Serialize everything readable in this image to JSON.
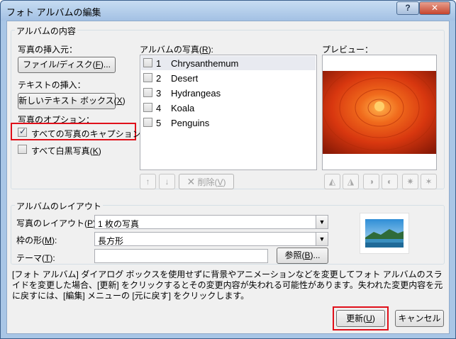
{
  "window": {
    "title": "フォト アルバムの編集",
    "help_glyph": "?",
    "close_glyph": "✕"
  },
  "album_contents": {
    "group_label": "アルバムの内容",
    "insert_from_label": "写真の挿入元：",
    "file_disk_button": {
      "text": "ファイル/ディスク(",
      "key": "F",
      "tail": ")..."
    },
    "insert_text_label": "テキストの挿入：",
    "new_textbox_button": {
      "text": "新しいテキスト ボックス(",
      "key": "X",
      "tail": ")"
    },
    "photo_options_label": "写真のオプション：",
    "caption_all": {
      "text": "すべての写真のキャプション(",
      "key": "A",
      "tail": ")",
      "checked": true
    },
    "bw_all": {
      "text": "すべて白黒写真(",
      "key": "K",
      "tail": ")",
      "checked": false
    },
    "photos_label": {
      "text": "アルバムの写真(",
      "key": "R",
      "tail": "):"
    },
    "photos": [
      {
        "num": "1",
        "name": "Chrysanthemum",
        "selected": true
      },
      {
        "num": "2",
        "name": "Desert",
        "selected": false
      },
      {
        "num": "3",
        "name": "Hydrangeas",
        "selected": false
      },
      {
        "num": "4",
        "name": "Koala",
        "selected": false
      },
      {
        "num": "5",
        "name": "Penguins",
        "selected": false
      }
    ],
    "delete_button": {
      "text": "削除(",
      "key": "V",
      "tail": ")"
    },
    "preview_label": "プレビュー："
  },
  "album_layout": {
    "group_label": "アルバムのレイアウト",
    "picture_layout_label": {
      "text": "写真のレイアウト(",
      "key": "P",
      "tail": "):"
    },
    "picture_layout_value": "1 枚の写真",
    "frame_shape_label": {
      "text": "枠の形(",
      "key": "M",
      "tail": "):"
    },
    "frame_shape_value": "長方形",
    "theme_label": {
      "text": "テーマ(",
      "key": "T",
      "tail": "):"
    },
    "theme_value": "",
    "browse_button": {
      "text": "参照(",
      "key": "B",
      "tail": ")..."
    }
  },
  "note": "[フォト アルバム] ダイアログ ボックスを使用せずに背景やアニメーションなどを変更してフォト アルバムのスライドを変更した場合、[更新] をクリックするとその変更内容が失われる可能性があります。失われた変更内容を元に戻すには、[編集] メニューの [元に戻す] をクリックします。",
  "footer": {
    "update_button": {
      "text": "更新(",
      "key": "U",
      "tail": ")"
    },
    "cancel_button": "キャンセル"
  },
  "colors": {
    "highlight_red": "#e0101a",
    "title_bar": "#a9c6e6",
    "flower": "#e8461a"
  }
}
